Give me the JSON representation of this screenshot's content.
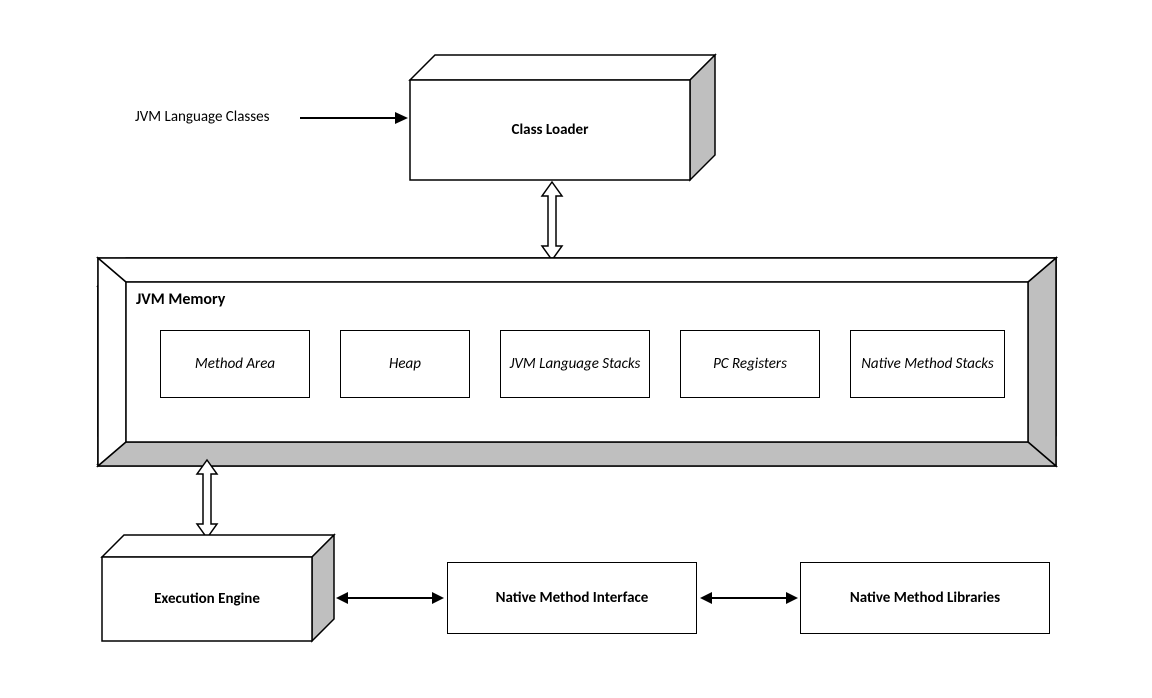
{
  "inputLabel": "JVM Language Classes",
  "classLoader": "Class Loader",
  "memoryTitle": "JVM Memory",
  "memoryAreas": {
    "methodArea": "Method Area",
    "heap": "Heap",
    "stacks": "JVM Language Stacks",
    "pcRegisters": "PC Registers",
    "nativeStacks": "Native Method Stacks"
  },
  "executionEngine": "Execution Engine",
  "nativeInterface": "Native Method Interface",
  "nativeLibraries": "Native Method Libraries"
}
